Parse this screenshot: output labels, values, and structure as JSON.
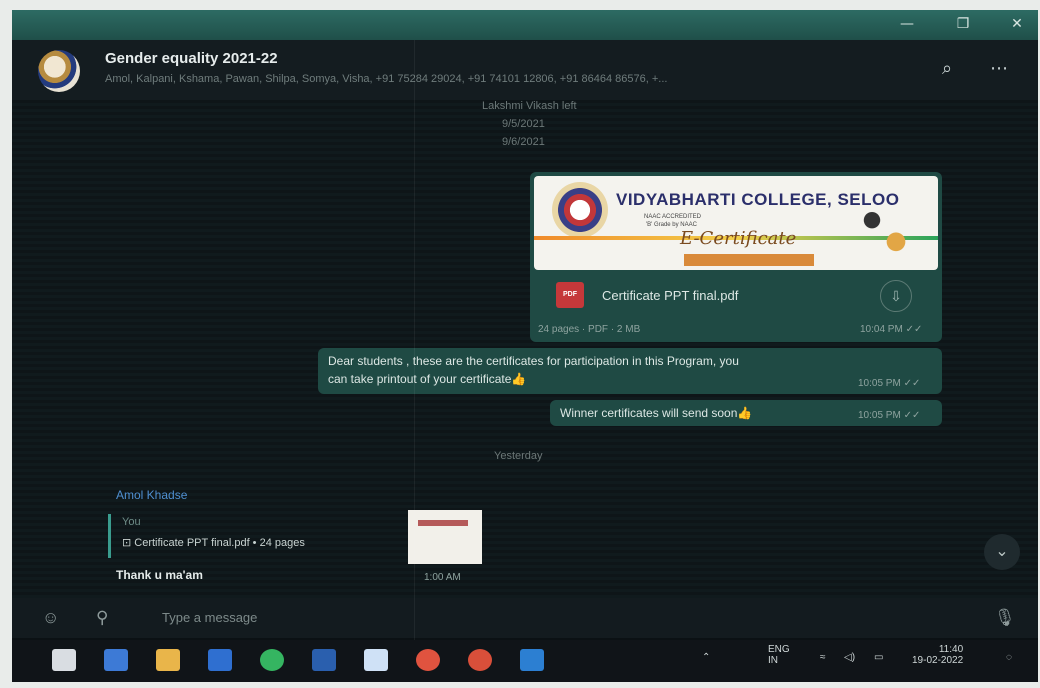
{
  "window": {
    "minimize_glyph": "—",
    "restore_glyph": "❐",
    "close_glyph": "✕"
  },
  "chat": {
    "title": "Gender equality 2021-22",
    "members": "Amol, Kalpani, Kshama, Pawan, Shilpa, Somya, Visha, +91 75284 29024, +91 74101 12806, +91 86464 86576, +...",
    "search_icon": "search-icon",
    "menu_icon": "more-icon"
  },
  "system": {
    "line1": "Lakshmi Vikash left",
    "line2": "9/5/2021",
    "line3": "9/6/2021",
    "day_label": "Yesterday"
  },
  "certificate_message": {
    "college": "VIDYABHARTI COLLEGE, SELOO",
    "small_line1": "NAAC ACCREDITED",
    "small_line2": "'B' Grade by NAAC",
    "e_certificate": "E-Certificate",
    "file_name": "Certificate PPT final.pdf",
    "file_meta": "24 pages · PDF · 2 MB",
    "time": "10:04 PM ✓✓"
  },
  "text_message_1": {
    "line1": "Dear students , these are the certificates for participation in this Program, you",
    "line2": "can take printout of your certificate👍",
    "time": "10:05 PM ✓✓"
  },
  "text_message_2": {
    "text": "Winner certificates will send soon👍",
    "time": "10:05 PM ✓✓"
  },
  "incoming": {
    "sender": "Amol Khadse",
    "quote_author": "You",
    "quote_file": "⊡ Certificate PPT final.pdf • 24 pages",
    "text": "Thank u ma'am",
    "time": "1:00 AM"
  },
  "composer": {
    "placeholder": "Type a message"
  },
  "tray": {
    "lang_top": "ENG",
    "lang_bottom": "IN",
    "time": "11:40",
    "date": "19-02-2022"
  }
}
